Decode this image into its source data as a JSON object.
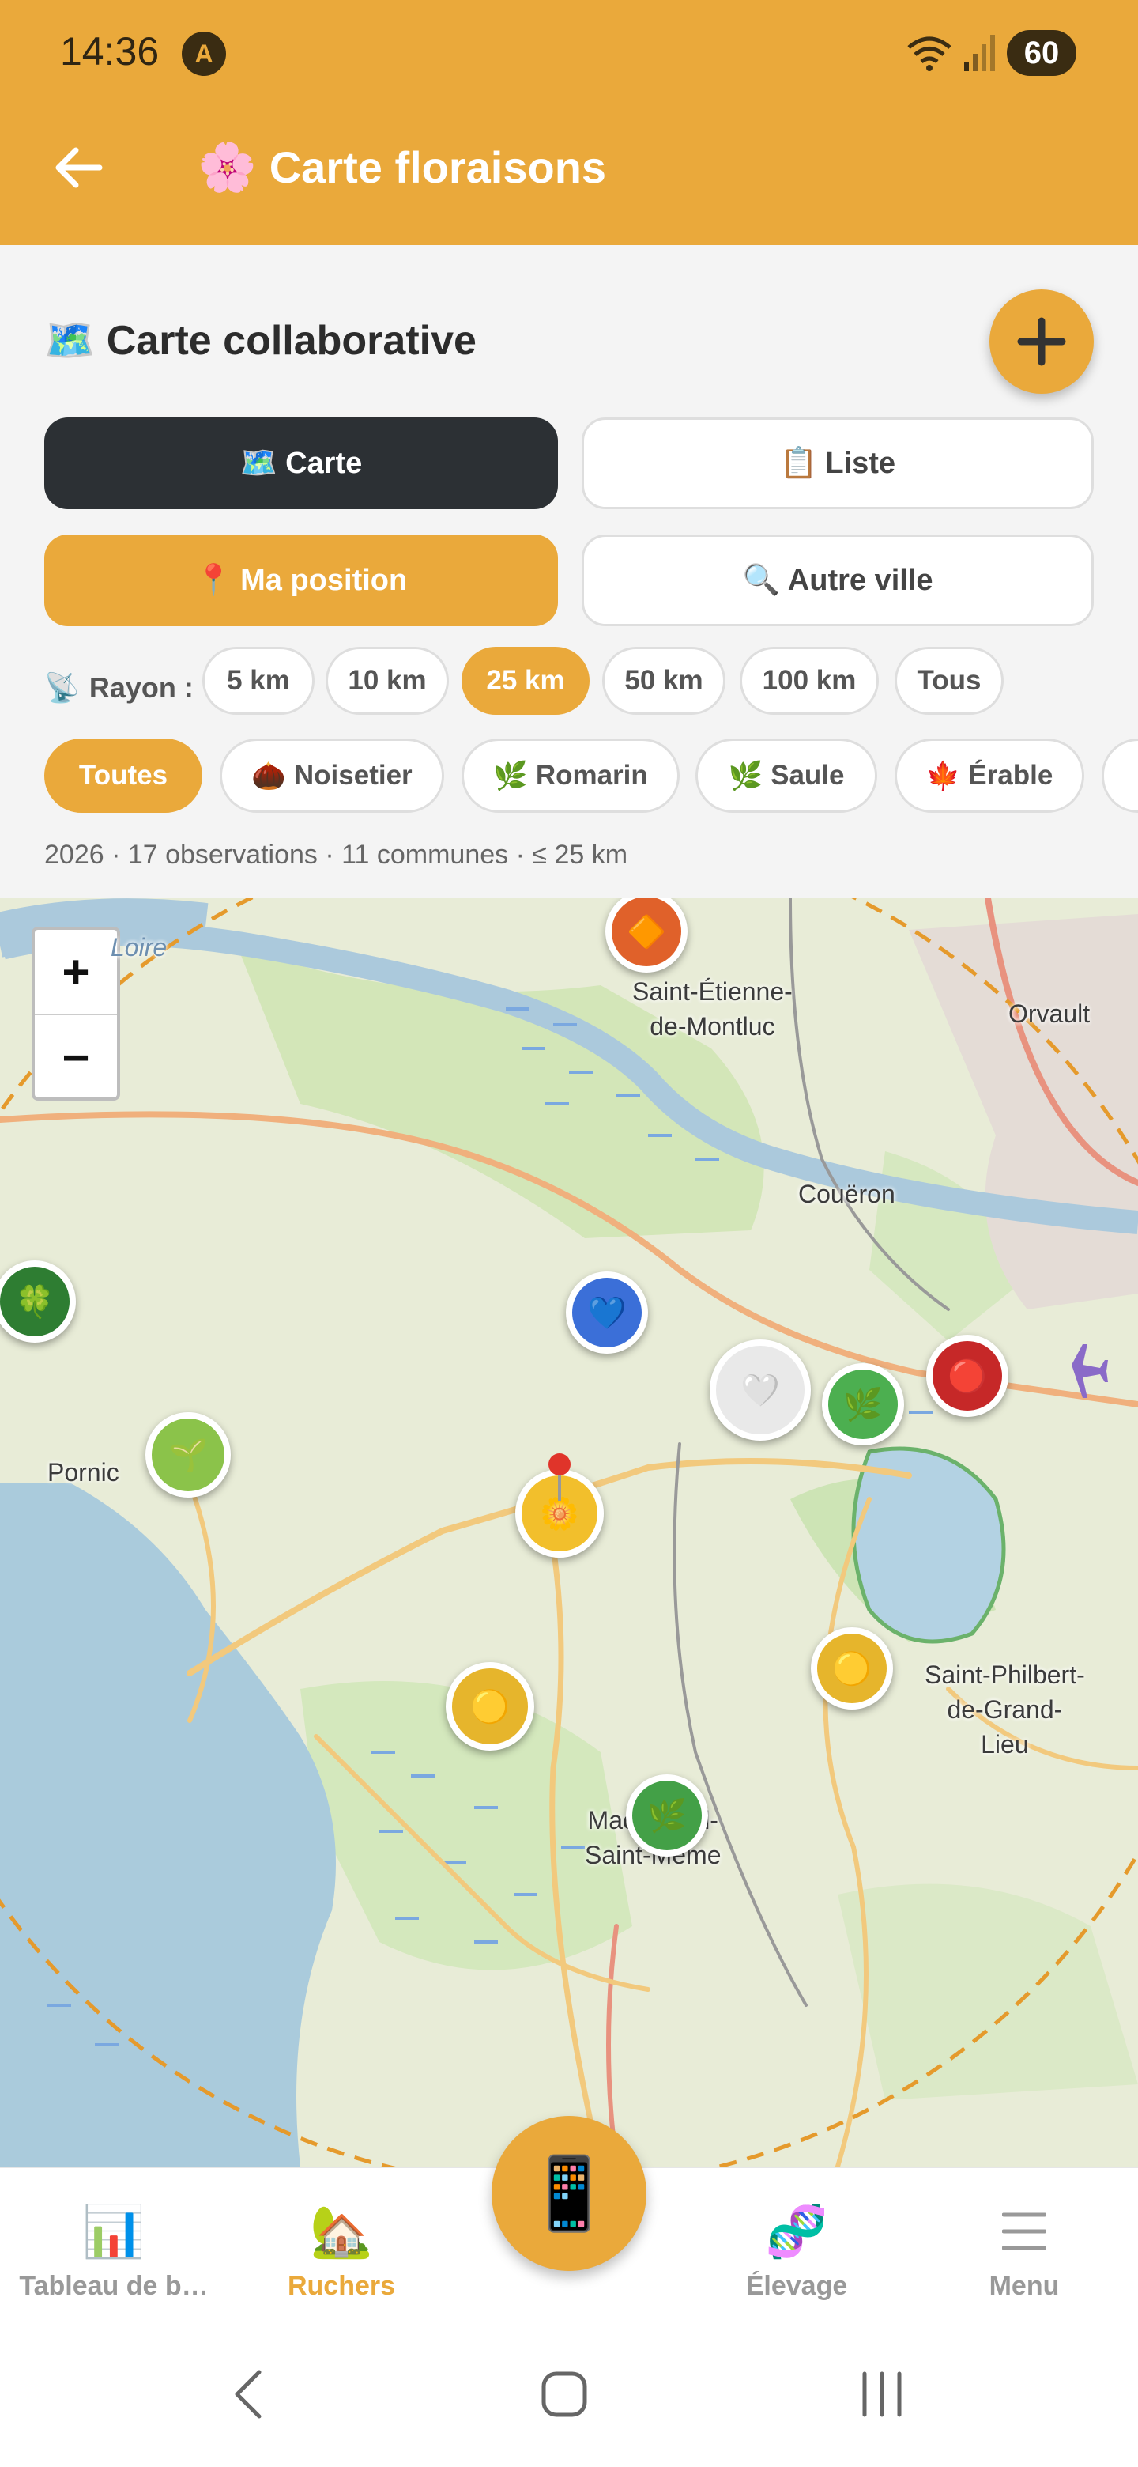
{
  "status_bar": {
    "time": "14:36",
    "notif_letter": "A",
    "battery": "60"
  },
  "app_bar": {
    "title": "Carte floraisons",
    "title_emoji": "🌸",
    "back_icon": "arrow-left-icon"
  },
  "header": {
    "title": "Carte collaborative",
    "title_emoji": "🗺️",
    "add_icon": "plus-icon"
  },
  "view_toggle": {
    "map": {
      "emoji": "🗺️",
      "label": "Carte"
    },
    "list": {
      "emoji": "📋",
      "label": "Liste"
    }
  },
  "location": {
    "my_position": {
      "emoji": "📍",
      "label": "Ma position"
    },
    "other_city": {
      "emoji": "🔍",
      "label": "Autre ville"
    }
  },
  "radius": {
    "emoji": "📡",
    "label": "Rayon :",
    "options": [
      "5 km",
      "10 km",
      "25 km",
      "50 km",
      "100 km",
      "Tous"
    ],
    "selected": "25 km"
  },
  "species_filters": [
    {
      "emoji": "",
      "label": "Toutes",
      "active": true
    },
    {
      "emoji": "🌰",
      "label": "Noisetier",
      "active": false
    },
    {
      "emoji": "🌿",
      "label": "Romarin",
      "active": false
    },
    {
      "emoji": "🌿",
      "label": "Saule",
      "active": false
    },
    {
      "emoji": "🍁",
      "label": "Érable",
      "active": false
    }
  ],
  "summary": "2026 · 17 observations · 11 communes · ≤ 25 km",
  "map": {
    "zoom_in": "+",
    "zoom_out": "−",
    "places": {
      "loire": "Loire",
      "st_etienne": "Saint-Étienne-\nde-Montluc",
      "orvault": "Orvault",
      "coueron": "Couëron",
      "pornic": "Pornic",
      "st_philbert": "Saint-Philbert-\nde-Grand-\nLieu",
      "machecoul": "Machecoul-\nSaint-Même"
    },
    "markers": [
      {
        "emoji": "🔶",
        "color": "#e0612a"
      },
      {
        "emoji": "🍀",
        "color": "#2e7d32"
      },
      {
        "emoji": "💙",
        "color": "#3b6fd8"
      },
      {
        "emoji": "🤍",
        "color": "#e9e9e9"
      },
      {
        "emoji": "🌿",
        "color": "#4caf50"
      },
      {
        "emoji": "🔴",
        "color": "#c62828"
      },
      {
        "emoji": "🌱",
        "color": "#8bc34a"
      },
      {
        "emoji": "🌼",
        "color": "#f2bf2c"
      },
      {
        "emoji": "🟡",
        "color": "#e6b52c"
      },
      {
        "emoji": "🟡",
        "color": "#e6b52c"
      },
      {
        "emoji": "🌿",
        "color": "#43a047"
      }
    ]
  },
  "bottom_nav": {
    "dashboard": {
      "emoji": "📊",
      "label": "Tableau de b…"
    },
    "apiaries": {
      "emoji": "🏡",
      "label": "Ruchers"
    },
    "center": {
      "emoji": "📱"
    },
    "breeding": {
      "emoji": "🧬",
      "label": "Élevage"
    },
    "menu": {
      "label": "Menu"
    }
  },
  "colors": {
    "accent": "#eaa93b",
    "dark_button": "#2c3034"
  }
}
